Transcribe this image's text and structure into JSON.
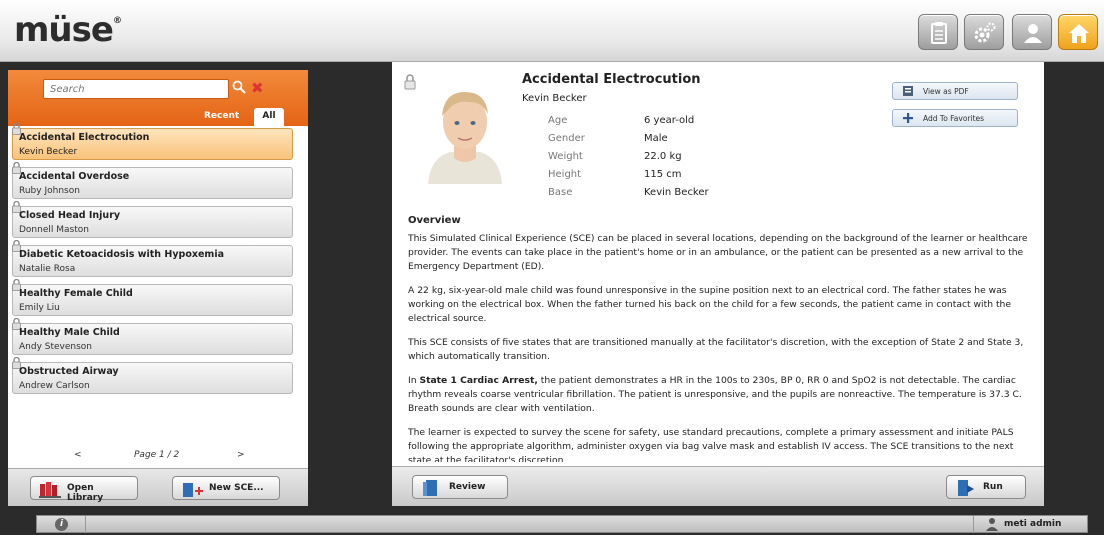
{
  "app": {
    "logo": "müse",
    "logo_mark": "®"
  },
  "header": {
    "buttons": [
      "notes-icon",
      "settings-icon",
      "user-icon",
      "home-icon"
    ]
  },
  "sidebar": {
    "search_placeholder": "Search",
    "tabs": {
      "recent": "Recent",
      "all": "All"
    },
    "items": [
      {
        "title": "Accidental Electrocution",
        "subtitle": "Kevin Becker",
        "selected": true
      },
      {
        "title": "Accidental Overdose",
        "subtitle": "Ruby Johnson"
      },
      {
        "title": "Closed Head Injury",
        "subtitle": "Donnell Maston"
      },
      {
        "title": "Diabetic Ketoacidosis with Hypoxemia",
        "subtitle": "Natalie Rosa"
      },
      {
        "title": "Healthy Female Child",
        "subtitle": "Emily Liu"
      },
      {
        "title": "Healthy Male Child",
        "subtitle": "Andy Stevenson"
      },
      {
        "title": "Obstructed Airway",
        "subtitle": "Andrew Carlson"
      }
    ],
    "pager": {
      "prev": "<",
      "page": "Page  1 / 2",
      "next": ">"
    },
    "open_library": "Open Library",
    "new_sce": "New SCE..."
  },
  "detail": {
    "title": "Accidental Electrocution",
    "patient": "Kevin Becker",
    "attributes": [
      {
        "key": "Age",
        "value": "6 year-old"
      },
      {
        "key": "Gender",
        "value": "Male"
      },
      {
        "key": "Weight",
        "value": "22.0 kg"
      },
      {
        "key": "Height",
        "value": "115 cm"
      },
      {
        "key": "Base",
        "value": "Kevin Becker"
      }
    ],
    "view_pdf": "View as PDF",
    "add_favorites": "Add To Favorites",
    "overview_heading": "Overview",
    "paragraphs": [
      "This Simulated Clinical Experience (SCE) can be placed in several locations, depending on the background of the learner or healthcare provider. The events can take place in the patient's home or in an ambulance, or the patient can be presented as a new arrival to the Emergency Department (ED).",
      "A 22 kg, six-year-old male child was found unresponsive in the supine position next to an electrical cord. The father states he was working on the electrical box. When the father turned his back on the child for a few seconds, the patient came in contact with the electrical source.",
      "This SCE consists of five states that are transitioned manually at the facilitator's discretion, with the exception of State 2 and State 3, which automatically transition."
    ],
    "state1_prefix": "In ",
    "state1_bold": "State 1 Cardiac Arrest,",
    "state1_rest": " the patient demonstrates a HR in the 100s to 230s, BP 0, RR 0 and SpO2 is not detectable. The cardiac rhythm reveals coarse ventricular fibrillation. The patient is unresponsive, and the pupils are nonreactive.  The temperature is 37.3 C.  Breath sounds are clear with ventilation.",
    "paragraph5": "The learner is expected to survey the scene for safety, use standard precautions, complete a primary assessment and initiate PALS following the appropriate algorithm, administer oxygen via bag valve mask and establish IV access. The SCE transitions to the next state at the facilitator's discretion.",
    "review": "Review",
    "run": "Run"
  },
  "statusbar": {
    "info": "i",
    "user": "meti admin"
  },
  "colors": {
    "accent": "#e8711f",
    "selected": "#f8c37a",
    "home": "#f3b12c"
  }
}
